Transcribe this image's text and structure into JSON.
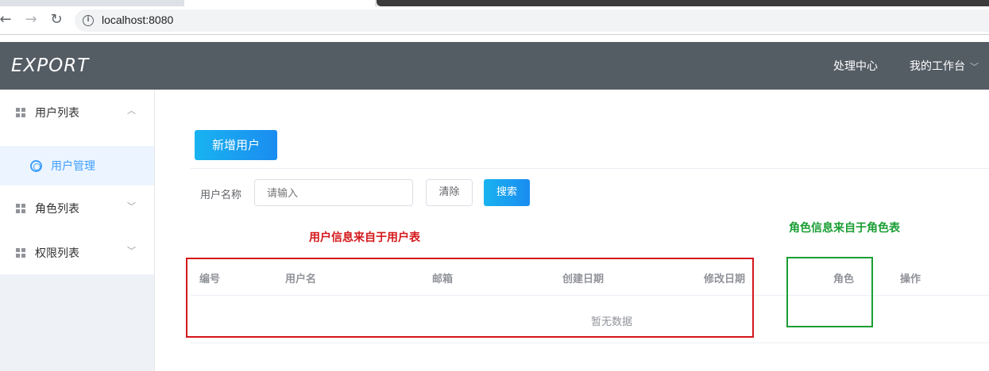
{
  "browser": {
    "url": "localhost:8080",
    "nav_back_glyph": "←",
    "nav_forward_glyph": "→",
    "nav_reload_glyph": "↻",
    "info_glyph": "i"
  },
  "header": {
    "logo": "EXPORT",
    "menu": [
      {
        "label": "处理中心"
      },
      {
        "label": "我的工作台",
        "icon": "chevron-down-icon"
      }
    ],
    "background": "#545c64"
  },
  "sidebar": {
    "items": [
      {
        "label": "用户列表",
        "icon": "grid-icon",
        "expanded": true,
        "arrow": "︿"
      },
      {
        "label": "用户管理",
        "icon": "life-ring-icon",
        "active": true
      },
      {
        "label": "角色列表",
        "icon": "grid-icon",
        "expanded": false,
        "arrow": "﹀"
      },
      {
        "label": "权限列表",
        "icon": "grid-icon",
        "expanded": false,
        "arrow": "﹀"
      }
    ],
    "active_color": "#409eff"
  },
  "main": {
    "add_button": "新增用户",
    "search": {
      "label": "用户名称",
      "placeholder": "请输入",
      "clear_button": "清除",
      "search_button": "搜索"
    },
    "annotations": {
      "red": "用户信息来自于用户表",
      "green": "角色信息来自于角色表",
      "red_color": "#d4171a",
      "green_color": "#1a9e33"
    },
    "table": {
      "columns": [
        "编号",
        "用户名",
        "邮箱",
        "创建日期",
        "修改日期",
        "角色",
        "操作"
      ],
      "empty_text": "暂无数据"
    }
  }
}
